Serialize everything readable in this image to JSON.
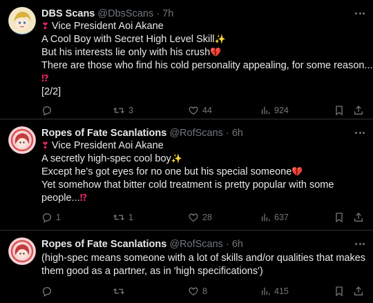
{
  "tweets": [
    {
      "name": "DBS Scans",
      "handle": "@DbsScans",
      "sep": "·",
      "time": "7h",
      "lines": [
        {
          "icon": "❣",
          "text": " Vice President Aoi Akane"
        },
        {
          "text": "A Cool Boy with Secret High Level Skill",
          "trail": "✨"
        },
        {
          "text": "But his interests lie only with his crush",
          "trail": "💔"
        },
        {
          "text": "There are those who find his cold personality appealing, for some reason..."
        },
        {
          "text": "",
          "trail": "⁉"
        },
        {
          "text": "[2/2]"
        }
      ],
      "replies": "",
      "retweets": "3",
      "likes": "44",
      "views": "924"
    },
    {
      "name": "Ropes of Fate Scanlations",
      "handle": "@RofScans",
      "sep": "·",
      "time": "6h",
      "lines": [
        {
          "icon": "❣",
          "text": " Vice President Aoi Akane"
        },
        {
          "text": "A secretly high-spec cool boy",
          "trail": "✨"
        },
        {
          "text": "Except he's got eyes for no one but his special someone",
          "trail": "💔"
        },
        {
          "text": "Yet somehow that bitter cold treatment is pretty popular with some"
        },
        {
          "text": "people...",
          "trail": "⁉"
        }
      ],
      "replies": "1",
      "retweets": "1",
      "likes": "28",
      "views": "637"
    },
    {
      "name": "Ropes of Fate Scanlations",
      "handle": "@RofScans",
      "sep": "·",
      "time": "6h",
      "lines": [
        {
          "text": "(high-spec means someone with a lot of skills and/or qualities that makes"
        },
        {
          "text": "them good as a partner, as in 'high specifications')"
        }
      ],
      "replies": "",
      "retweets": "",
      "likes": "8",
      "views": "415"
    }
  ],
  "colors": {
    "background": "#000000",
    "text": "#e7e9ea",
    "muted": "#71767b",
    "divider": "#2f3336",
    "heart_red": "#e0245e",
    "sparkle": "#ffcc33"
  },
  "icons": [
    "more-dots-icon",
    "reply-icon",
    "retweet-icon",
    "like-icon",
    "views-icon",
    "bookmark-icon",
    "share-icon"
  ]
}
